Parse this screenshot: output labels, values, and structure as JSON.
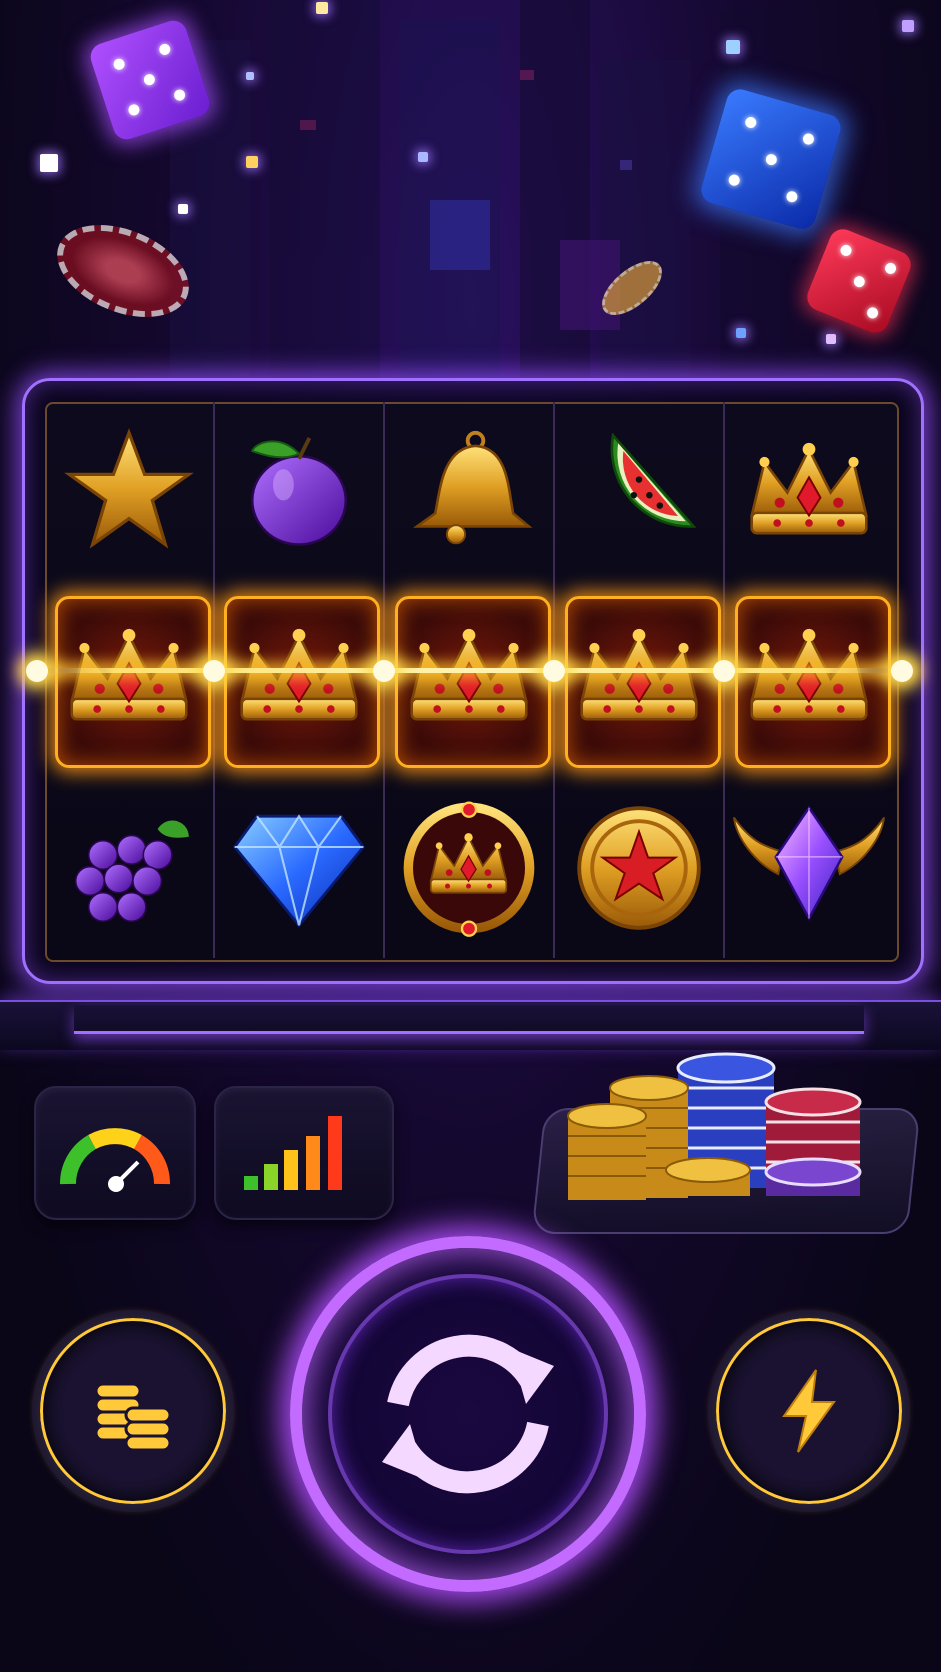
{
  "game": {
    "reels": [
      [
        "star",
        "crown",
        "grapes"
      ],
      [
        "plum",
        "crown",
        "diamond"
      ],
      [
        "bell",
        "crown",
        "crown-laurel-emblem"
      ],
      [
        "watermelon",
        "crown",
        "star-coin"
      ],
      [
        "crown",
        "crown",
        "winged-purple-gem"
      ]
    ],
    "winning_row": 2,
    "winning_symbol": "crown",
    "controls": {
      "volatility_icon": "gauge-icon",
      "stats_icon": "signal-bars-icon",
      "bet_icon": "coin-stack-icon",
      "spin_icon": "refresh-arrows-icon",
      "turbo_icon": "lightning-icon"
    },
    "colors": {
      "accent": "#c46bff",
      "gold": "#ffc93a",
      "win_glow": "#ffb020",
      "background": "#0e0622"
    }
  }
}
